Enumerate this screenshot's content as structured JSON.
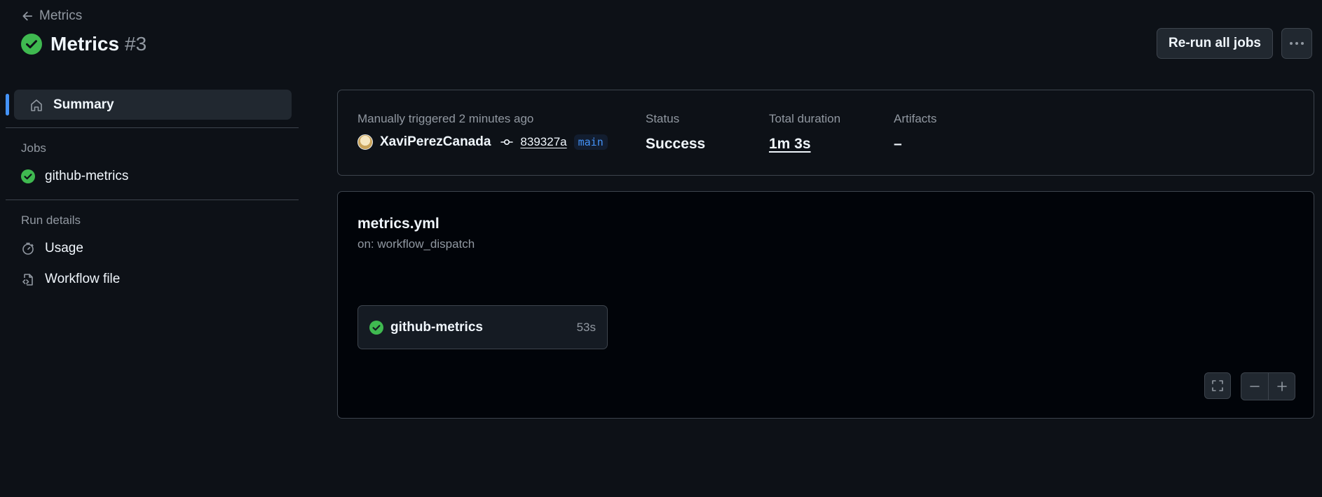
{
  "header": {
    "back_label": "Metrics",
    "title": "Metrics",
    "run_number": "#3",
    "rerun_label": "Re-run all jobs",
    "more_label": "···"
  },
  "sidebar": {
    "summary_label": "Summary",
    "jobs_heading": "Jobs",
    "jobs": [
      {
        "label": "github-metrics",
        "status": "success"
      }
    ],
    "run_details_heading": "Run details",
    "usage_label": "Usage",
    "workflow_file_label": "Workflow file"
  },
  "summary": {
    "trigger_text": "Manually triggered 2 minutes ago",
    "actor": "XaviPerezCanada",
    "commit": "839327a",
    "branch": "main",
    "status_label": "Status",
    "status_value": "Success",
    "duration_label": "Total duration",
    "duration_value": "1m 3s",
    "artifacts_label": "Artifacts",
    "artifacts_value": "–"
  },
  "graph": {
    "workflow_file": "metrics.yml",
    "trigger": "on: workflow_dispatch",
    "job": {
      "name": "github-metrics",
      "duration": "53s"
    }
  },
  "colors": {
    "success": "#3fb950",
    "accent": "#4493f8",
    "background": "#0d1117"
  }
}
